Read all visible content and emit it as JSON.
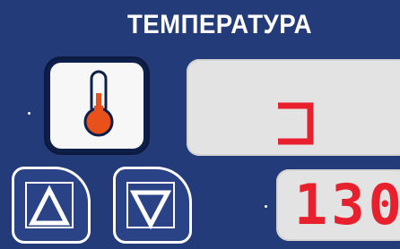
{
  "panel": {
    "title": "ТЕМПЕРАТУРА",
    "background_color": "#243b7a"
  },
  "temperature_button": {
    "icon": "thermometer-icon",
    "bulb_color": "#e8511a"
  },
  "display_top": {
    "symbol": "ɔ",
    "text_color": "#e8202e"
  },
  "display_bottom": {
    "value": "130",
    "text_color": "#e8202e"
  },
  "controls": {
    "increase_icon": "triangle-up-icon",
    "decrease_icon": "triangle-down-icon"
  }
}
